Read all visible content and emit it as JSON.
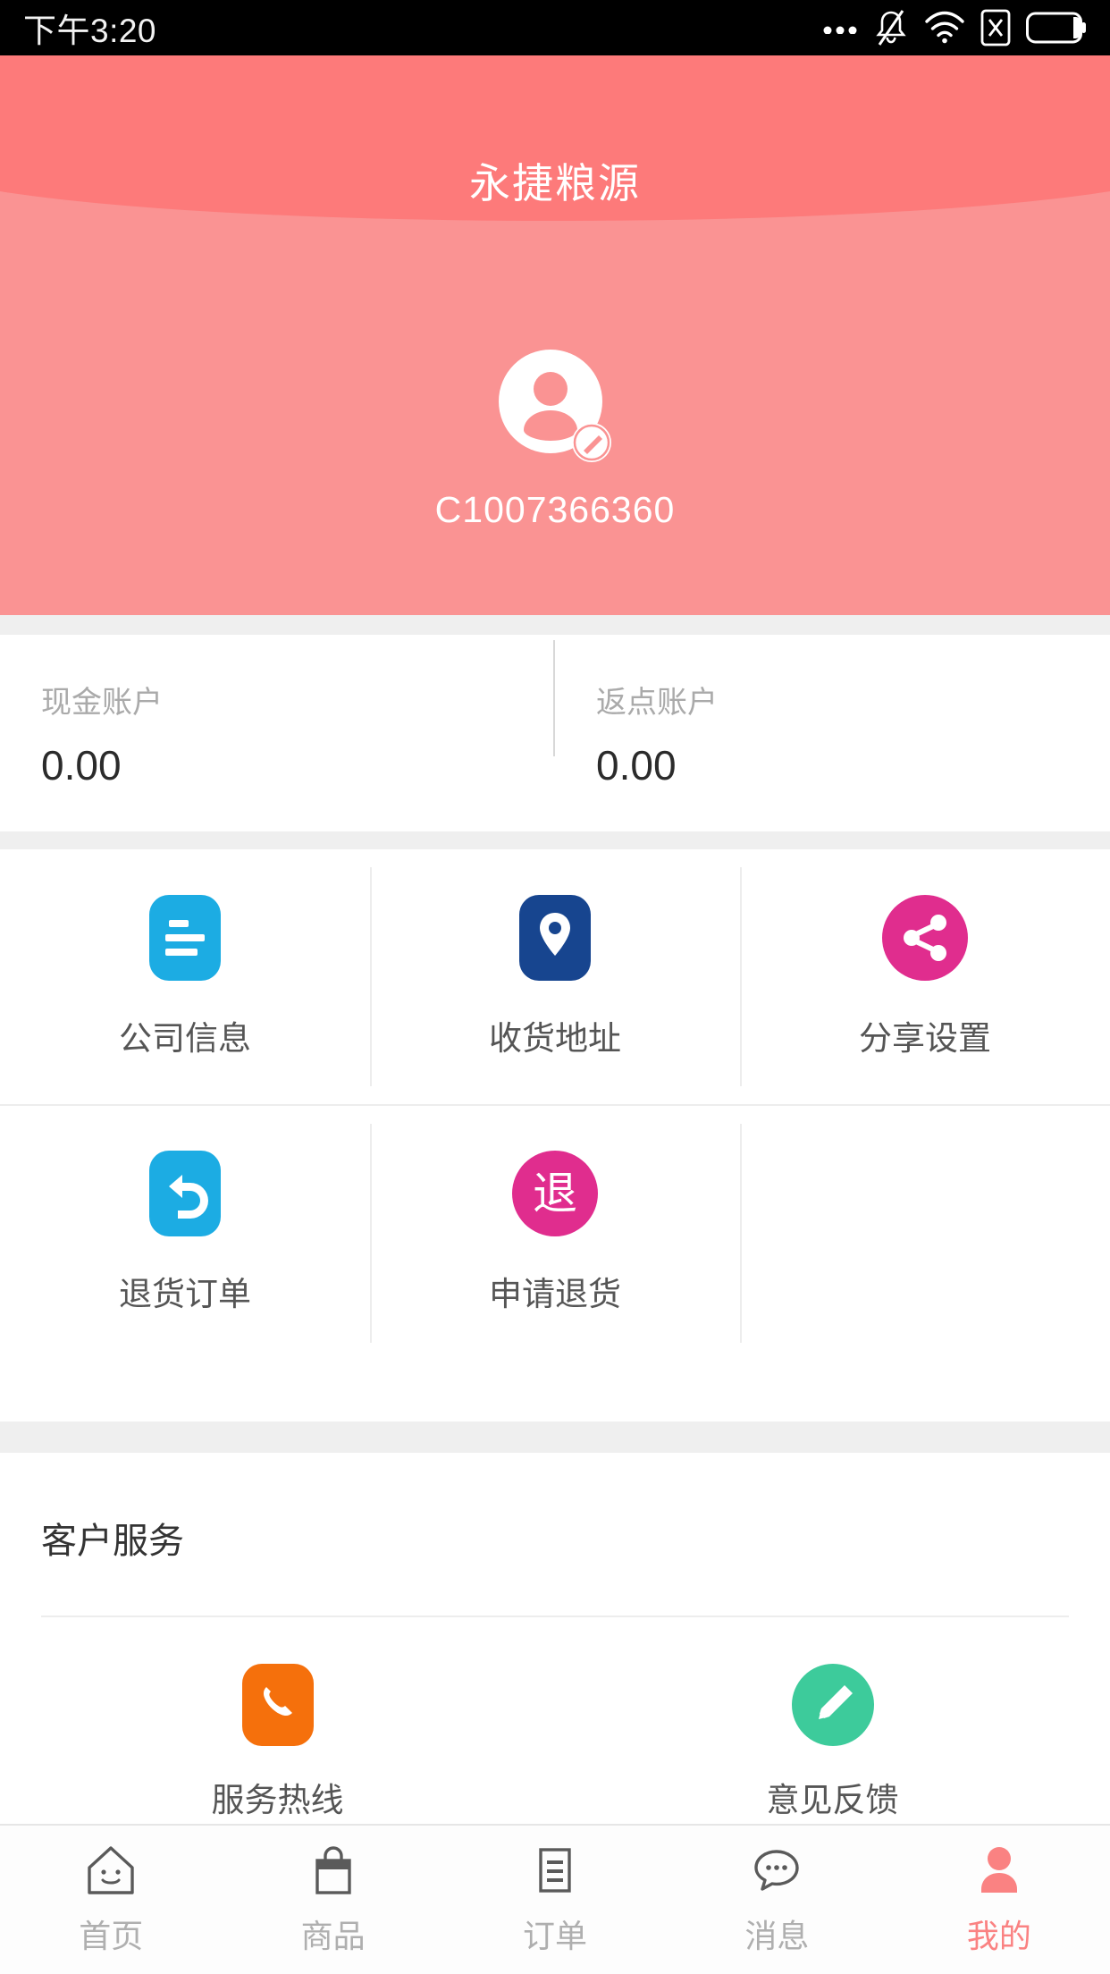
{
  "status_bar": {
    "time": "下午3:20",
    "icons": [
      "more-dots-icon",
      "silent-bell-icon",
      "wifi-icon",
      "sim-x-icon",
      "battery-icon"
    ]
  },
  "header": {
    "title": "永捷粮源",
    "avatar_icon": "user-avatar-icon",
    "edit_badge_icon": "edit-pencil-badge-icon",
    "username": "C1007366360",
    "band_color_top": "#FD7A7A",
    "band_color_bottom": "#FA9393"
  },
  "accounts": [
    {
      "label": "现金账户",
      "value": "0.00"
    },
    {
      "label": "返点账户",
      "value": "0.00"
    }
  ],
  "grid": {
    "rows": [
      [
        {
          "label": "公司信息",
          "icon": "company-info-icon",
          "color": "#1CACE3"
        },
        {
          "label": "收货地址",
          "icon": "location-pin-icon",
          "color": "#17458F"
        },
        {
          "label": "分享设置",
          "icon": "share-nodes-icon",
          "color": "#E02D8E"
        }
      ],
      [
        {
          "label": "退货订单",
          "icon": "return-arrow-icon",
          "color": "#1CACE3"
        },
        {
          "label": "申请退货",
          "icon": "refund-char-icon",
          "color": "#E02D8E",
          "glyph": "退"
        },
        {
          "label": "",
          "icon": "",
          "color": ""
        }
      ]
    ]
  },
  "service": {
    "title": "客户服务",
    "items": [
      {
        "label": "服务热线",
        "icon": "phone-icon",
        "color": "#F5700C"
      },
      {
        "label": "意见反馈",
        "icon": "pencil-icon",
        "color": "#3DCB9B"
      }
    ]
  },
  "tabbar": {
    "active_color": "#FA8282",
    "inactive_color": "#AFAFAF",
    "items": [
      {
        "label": "首页",
        "icon": "home-smile-icon",
        "active": false
      },
      {
        "label": "商品",
        "icon": "shopping-bag-icon",
        "active": false
      },
      {
        "label": "订单",
        "icon": "order-list-icon",
        "active": false
      },
      {
        "label": "消息",
        "icon": "chat-bubble-icon",
        "active": false
      },
      {
        "label": "我的",
        "icon": "person-icon",
        "active": true
      }
    ]
  }
}
